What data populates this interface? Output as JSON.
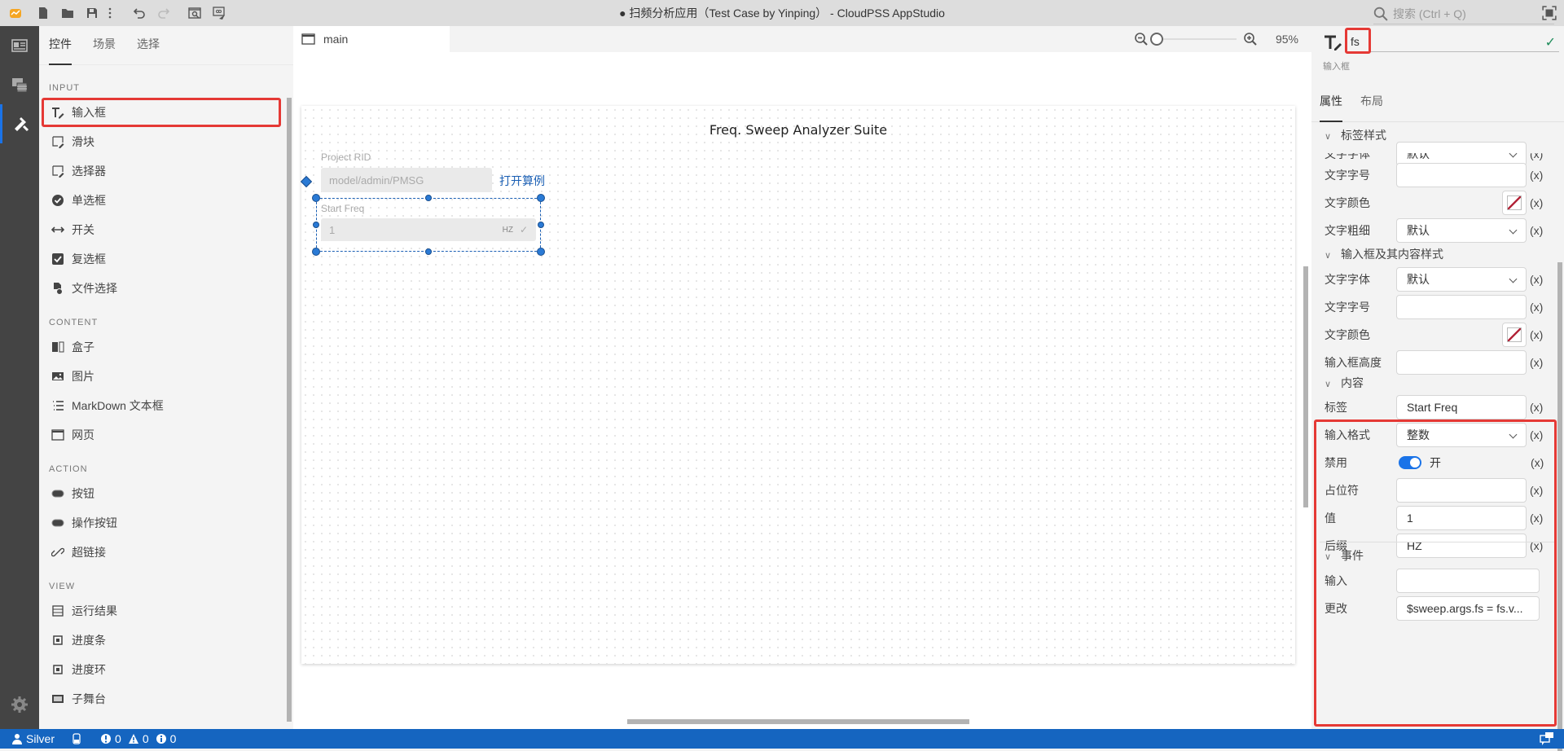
{
  "window": {
    "title": "● 扫频分析应用（Test Case by Yinping） - CloudPSS AppStudio",
    "search_placeholder": "搜索 (Ctrl + Q)"
  },
  "toolbar": {
    "icons": [
      "app-logo-icon",
      "new-file-icon",
      "open-folder-icon",
      "save-icon",
      "more-vertical-icon",
      "undo-icon",
      "redo-icon",
      "preview-icon",
      "publish-icon"
    ]
  },
  "activity_bar": {
    "items": [
      "layout-icon",
      "media-icon",
      "tools-icon"
    ],
    "active": "tools-icon",
    "settings": "gear-icon"
  },
  "left_panel": {
    "tabs": [
      "控件",
      "场景",
      "选择"
    ],
    "active_tab": "控件",
    "sections": [
      {
        "title": "INPUT",
        "items": [
          {
            "label": "输入框",
            "icon": "text-input-icon",
            "highlighted": true
          },
          {
            "label": "滑块",
            "icon": "slider-icon"
          },
          {
            "label": "选择器",
            "icon": "selector-icon"
          },
          {
            "label": "单选框",
            "icon": "radio-icon"
          },
          {
            "label": "开关",
            "icon": "switch-icon"
          },
          {
            "label": "复选框",
            "icon": "checkbox-icon"
          },
          {
            "label": "文件选择",
            "icon": "file-select-icon"
          }
        ]
      },
      {
        "title": "CONTENT",
        "items": [
          {
            "label": "盒子",
            "icon": "box-icon"
          },
          {
            "label": "图片",
            "icon": "image-icon"
          },
          {
            "label": "MarkDown 文本框",
            "icon": "markdown-icon"
          },
          {
            "label": "网页",
            "icon": "webpage-icon"
          }
        ]
      },
      {
        "title": "ACTION",
        "items": [
          {
            "label": "按钮",
            "icon": "button-icon"
          },
          {
            "label": "操作按钮",
            "icon": "action-button-icon"
          },
          {
            "label": "超链接",
            "icon": "link-icon"
          }
        ]
      },
      {
        "title": "VIEW",
        "items": [
          {
            "label": "运行结果",
            "icon": "result-icon"
          },
          {
            "label": "进度条",
            "icon": "progress-bar-icon"
          },
          {
            "label": "进度环",
            "icon": "progress-ring-icon"
          },
          {
            "label": "子舞台",
            "icon": "substage-icon"
          }
        ]
      }
    ]
  },
  "canvas": {
    "tab": "main",
    "zoom": "95%",
    "zoom_level_percent": 95,
    "stage": {
      "title": "Freq. Sweep Analyzer Suite",
      "project_rid_label": "Project RID",
      "project_rid_value": "model/admin/PMSG",
      "open_link": "打开算例",
      "start_freq_label": "Start Freq",
      "start_freq_value": "1",
      "start_freq_suffix": "HZ"
    }
  },
  "right_panel": {
    "component_name": "fs",
    "component_type": "输入框",
    "tabs": [
      "属性",
      "布局"
    ],
    "active_tab": "属性",
    "x_label": "(x)",
    "label_style": {
      "title": "标签样式",
      "rows": [
        {
          "label": "文字字体",
          "value": "默认",
          "type": "select"
        },
        {
          "label": "文字字号",
          "value": "",
          "type": "input"
        },
        {
          "label": "文字颜色",
          "value": "",
          "type": "color"
        },
        {
          "label": "文字粗细",
          "value": "默认",
          "type": "select"
        }
      ]
    },
    "input_style": {
      "title": "输入框及其内容样式",
      "rows": [
        {
          "label": "文字字体",
          "value": "默认",
          "type": "select"
        },
        {
          "label": "文字字号",
          "value": "",
          "type": "input"
        },
        {
          "label": "文字颜色",
          "value": "",
          "type": "color"
        },
        {
          "label": "输入框高度",
          "value": "",
          "type": "input"
        }
      ]
    },
    "content": {
      "title": "内容",
      "rows": [
        {
          "label": "标签",
          "value": "Start Freq",
          "type": "input"
        },
        {
          "label": "输入格式",
          "value": "整数",
          "type": "select"
        },
        {
          "label": "禁用",
          "value": "开",
          "type": "toggle",
          "on": true
        },
        {
          "label": "占位符",
          "value": "",
          "type": "input"
        },
        {
          "label": "值",
          "value": "1",
          "type": "input"
        },
        {
          "label": "后缀",
          "value": "HZ",
          "type": "input"
        }
      ]
    },
    "events": {
      "title": "事件",
      "rows": [
        {
          "label": "输入",
          "value": ""
        },
        {
          "label": "更改",
          "value": "$sweep.args.fs = fs.v..."
        }
      ]
    }
  },
  "status_bar": {
    "user": "Silver",
    "errors": "0",
    "warnings": "0",
    "infos": "0"
  }
}
